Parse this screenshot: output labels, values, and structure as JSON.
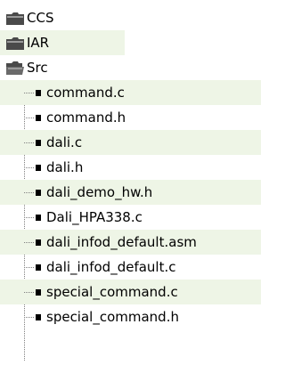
{
  "tree": {
    "folders": [
      {
        "label": "CCS",
        "icon": "folder-closed-icon",
        "shaded": false
      },
      {
        "label": "IAR",
        "icon": "folder-closed-icon",
        "shaded": true
      },
      {
        "label": "Src",
        "icon": "folder-open-icon",
        "shaded": false
      }
    ],
    "src_files": [
      {
        "label": "command.c",
        "shaded": true
      },
      {
        "label": "command.h",
        "shaded": false
      },
      {
        "label": "dali.c",
        "shaded": true
      },
      {
        "label": "dali.h",
        "shaded": false
      },
      {
        "label": "dali_demo_hw.h",
        "shaded": true
      },
      {
        "label": "Dali_HPA338.c",
        "shaded": false
      },
      {
        "label": "dali_infod_default.asm",
        "shaded": true
      },
      {
        "label": "dali_infod_default.c",
        "shaded": false
      },
      {
        "label": "special_command.c",
        "shaded": true
      },
      {
        "label": "special_command.h",
        "shaded": false
      }
    ]
  },
  "colors": {
    "row_shade": "#eef5e6",
    "folder_body": "#4a4a4a",
    "folder_highlight": "#9a9a9a",
    "connector": "#7f7f7f"
  }
}
